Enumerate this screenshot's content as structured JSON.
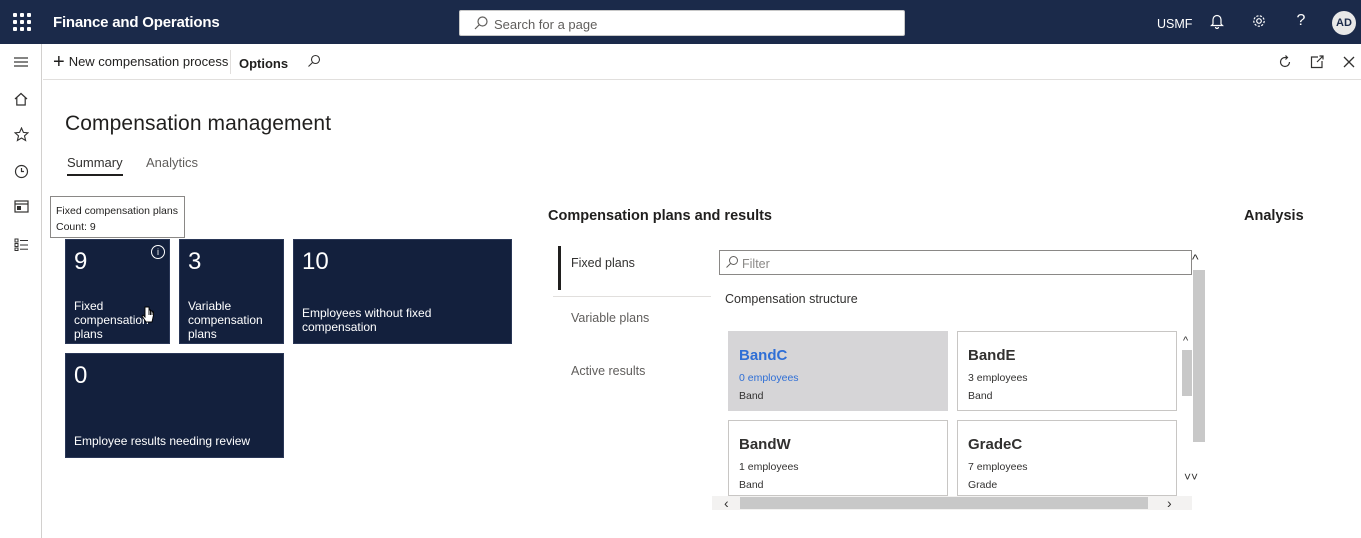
{
  "header": {
    "app_title": "Finance and Operations",
    "search_placeholder": "Search for a page",
    "company": "USMF",
    "avatar_initials": "AD",
    "help_glyph": "?",
    "colors": {
      "nav_bg": "#1b2a4a",
      "tile_bg": "#13203d",
      "link": "#2f6fd6"
    }
  },
  "left_nav": {
    "icons": [
      "hamburger-icon",
      "home-icon",
      "star-icon",
      "clock-icon",
      "workspace-icon",
      "list-icon"
    ]
  },
  "action_pane": {
    "new_label": "New compensation process",
    "options_label": "Options"
  },
  "page": {
    "title": "Compensation management",
    "tabs": [
      "Summary",
      "Analytics"
    ],
    "active_tab": "Summary"
  },
  "tooltip": {
    "title": "Fixed compensation plans",
    "count": "Count: 9"
  },
  "tiles": [
    {
      "count": "9",
      "label": "Fixed compensation plans"
    },
    {
      "count": "3",
      "label": "Variable compensation plans"
    },
    {
      "count": "10",
      "label": "Employees without fixed compensation"
    },
    {
      "count": "0",
      "label": "Employee results needing review"
    }
  ],
  "plans_section": {
    "title": "Compensation plans and results",
    "vertical_tabs": [
      "Fixed plans",
      "Variable plans",
      "Active results"
    ],
    "selected_tab": "Fixed plans",
    "filter_placeholder": "Filter",
    "structure_label": "Compensation structure",
    "cards": [
      {
        "name": "BandC",
        "employees": "0 employees",
        "type": "Band",
        "selected": true
      },
      {
        "name": "BandE",
        "employees": "3 employees",
        "type": "Band",
        "selected": false
      },
      {
        "name": "BandW",
        "employees": "1 employees",
        "type": "Band",
        "selected": false
      },
      {
        "name": "GradeC",
        "employees": "7 employees",
        "type": "Grade",
        "selected": false
      }
    ]
  },
  "analysis": {
    "title": "Analysis"
  }
}
